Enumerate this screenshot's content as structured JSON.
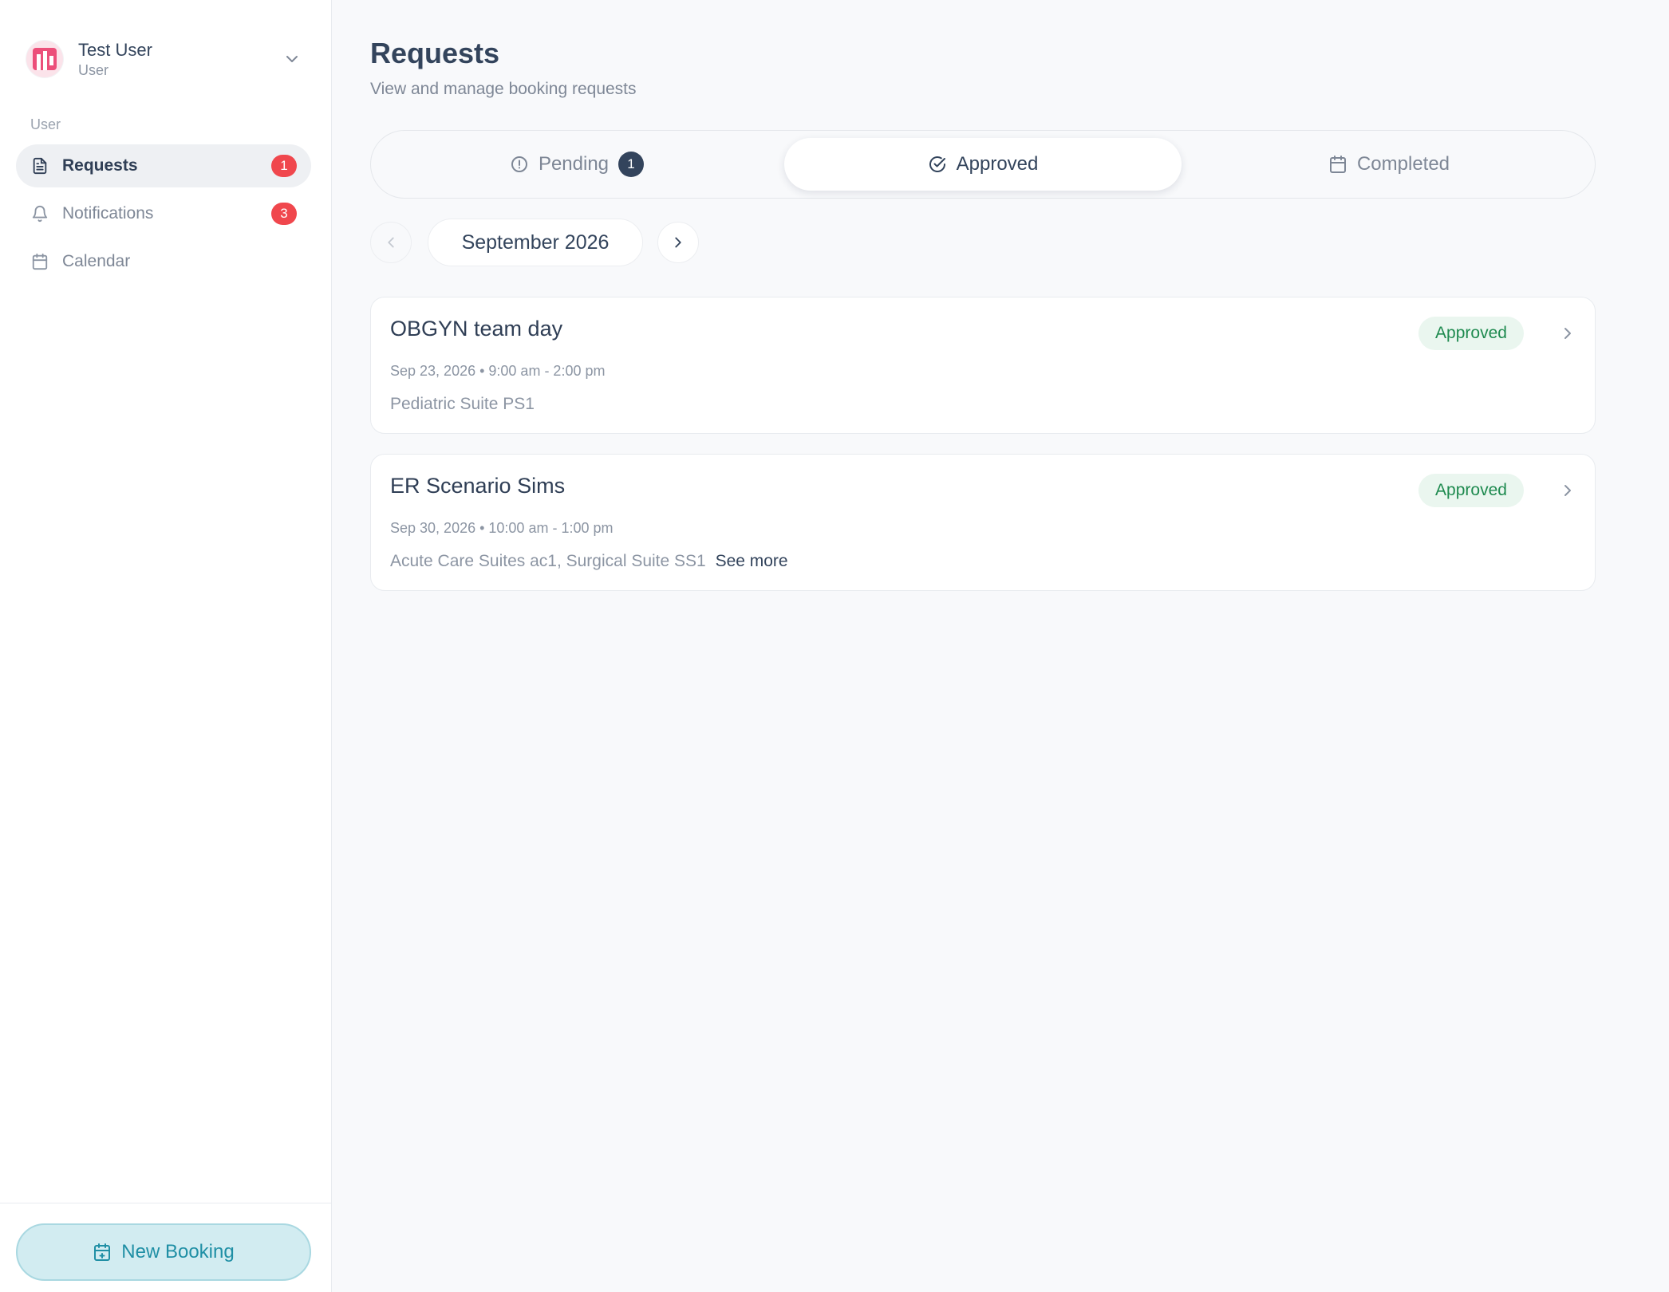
{
  "user": {
    "name": "Test User",
    "role": "User"
  },
  "sidebar": {
    "section_label": "User",
    "items": [
      {
        "label": "Requests",
        "icon": "document-icon",
        "badge": "1",
        "active": true
      },
      {
        "label": "Notifications",
        "icon": "bell-icon",
        "badge": "3",
        "active": false
      },
      {
        "label": "Calendar",
        "icon": "calendar-icon",
        "badge": null,
        "active": false
      }
    ],
    "new_booking_label": "New Booking"
  },
  "header": {
    "title": "Requests",
    "subtitle": "View and manage booking requests"
  },
  "tabs": [
    {
      "label": "Pending",
      "icon": "alert-circle-icon",
      "badge": "1",
      "active": false
    },
    {
      "label": "Approved",
      "icon": "check-circle-icon",
      "badge": null,
      "active": true
    },
    {
      "label": "Completed",
      "icon": "calendar-icon",
      "badge": null,
      "active": false
    }
  ],
  "month_nav": {
    "label": "September 2026"
  },
  "requests": [
    {
      "title": "OBGYN team day",
      "meta": "Sep 23, 2026 • 9:00 am - 2:00 pm",
      "location": "Pediatric Suite PS1",
      "status": "Approved",
      "see_more": null
    },
    {
      "title": "ER Scenario Sims",
      "meta": "Sep 30, 2026 • 10:00 am - 1:00 pm",
      "location": "Acute Care Suites ac1, Surgical Suite SS1",
      "status": "Approved",
      "see_more": "See more"
    }
  ],
  "colors": {
    "accent": "#1f8fa5",
    "badge_red": "#f0474d",
    "approved_text": "#1e8a4f",
    "approved_bg": "#eaf6ef",
    "avatar_brand": "#ec4f7a"
  }
}
